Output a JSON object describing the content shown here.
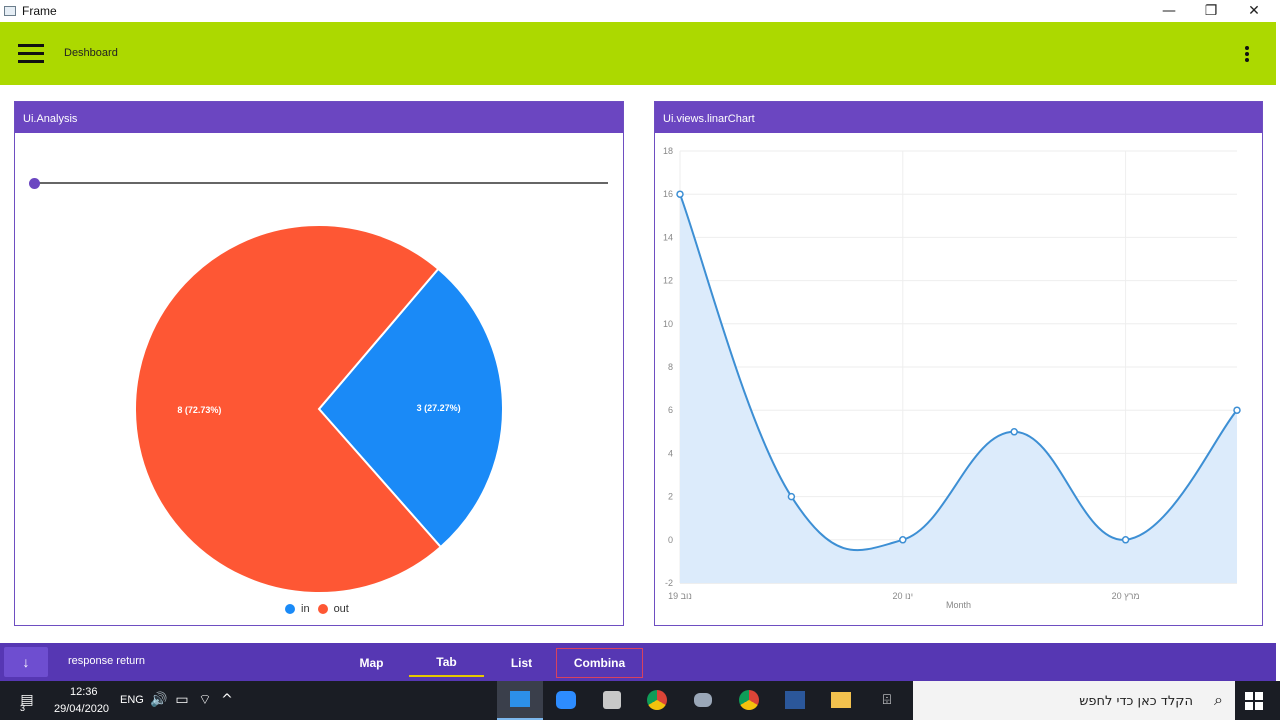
{
  "window": {
    "title": "Frame",
    "minimize": "—",
    "restore": "❐",
    "close": "✕"
  },
  "appbar": {
    "title": "Deshboard"
  },
  "left_card": {
    "title": "Ui.Analysis",
    "slider_value": 0
  },
  "right_card": {
    "title": "Ui.views.linarChart"
  },
  "pie_labels": {
    "in": "3 (27.27%)",
    "out": "8 (72.73%)"
  },
  "legend": {
    "in": "in",
    "out": "out"
  },
  "colors": {
    "appbar": "#acd900",
    "purple": "#6b46c1",
    "pie_in": "#1a8af7",
    "pie_out": "#fe5734",
    "line": "#3d8fd4",
    "area": "#dcebfb"
  },
  "bottombar": {
    "fab_icon": "↓",
    "response": "response return",
    "tabs": [
      {
        "label": "Map"
      },
      {
        "label": "Tab"
      },
      {
        "label": "List"
      },
      {
        "label": "Combina"
      }
    ]
  },
  "taskbar": {
    "notif_badge": "3",
    "time": "12:36",
    "date": "29/04/2020",
    "lang": "ENG",
    "search_placeholder": "הקלד כאן כדי לחפש"
  },
  "chart_data": [
    {
      "type": "pie",
      "categories": [
        "in",
        "out"
      ],
      "values": [
        3,
        8
      ],
      "data_labels": [
        "3 (27.27%)",
        "8 (72.73%)"
      ],
      "legend": "bottom"
    },
    {
      "type": "area",
      "x": [
        0,
        1,
        2,
        3,
        4,
        5
      ],
      "values": [
        16,
        2,
        0,
        5,
        0,
        6
      ],
      "x_tick_labels": [
        "נוב 19",
        "ינו 20",
        "מרץ 20"
      ],
      "x_tick_positions": [
        0,
        2,
        4
      ],
      "xlabel": "Month",
      "ylabel": "",
      "ylim": [
        -2,
        18
      ],
      "yticks": [
        -2,
        0,
        2,
        4,
        6,
        8,
        10,
        12,
        14,
        16,
        18
      ],
      "grid": true
    }
  ]
}
